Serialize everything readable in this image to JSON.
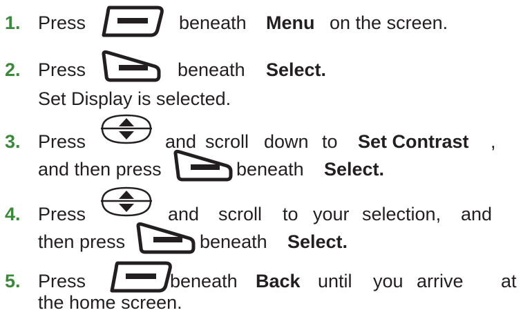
{
  "accent_color": "#3a8a3a",
  "icons": {
    "left_softkey": "left-softkey-icon",
    "right_softkey": "right-softkey-icon",
    "scroll_key": "scroll-key-icon"
  },
  "steps": [
    {
      "number": "1.",
      "w1": "Press",
      "w2": "beneath",
      "bold": "Menu",
      "w3": "on the screen."
    },
    {
      "number": "2.",
      "w1": "Press",
      "w2": "beneath",
      "bold": "Select.",
      "line2": "Set Display is selected."
    },
    {
      "number": "3.",
      "w1": "Press",
      "w2": "and",
      "w3": "scroll",
      "w4": "down",
      "w5": "to",
      "bold": "Set Contrast",
      "comma": ",",
      "line2a": "and then press",
      "line2b": "beneath",
      "bold2": "Select."
    },
    {
      "number": "4.",
      "w1": "Press",
      "w2": "and",
      "w3": "scroll",
      "w4": "to",
      "w5": "your",
      "w6": "selection,",
      "w7": "and",
      "line2a": "then press",
      "line2b": "beneath",
      "bold2": "Select."
    },
    {
      "number": "5.",
      "w1": "Press",
      "w2": "beneath",
      "bold": "Back",
      "w3": "until",
      "w4": "you",
      "w5": "arrive",
      "w6": "at",
      "line2": "the home screen."
    }
  ]
}
